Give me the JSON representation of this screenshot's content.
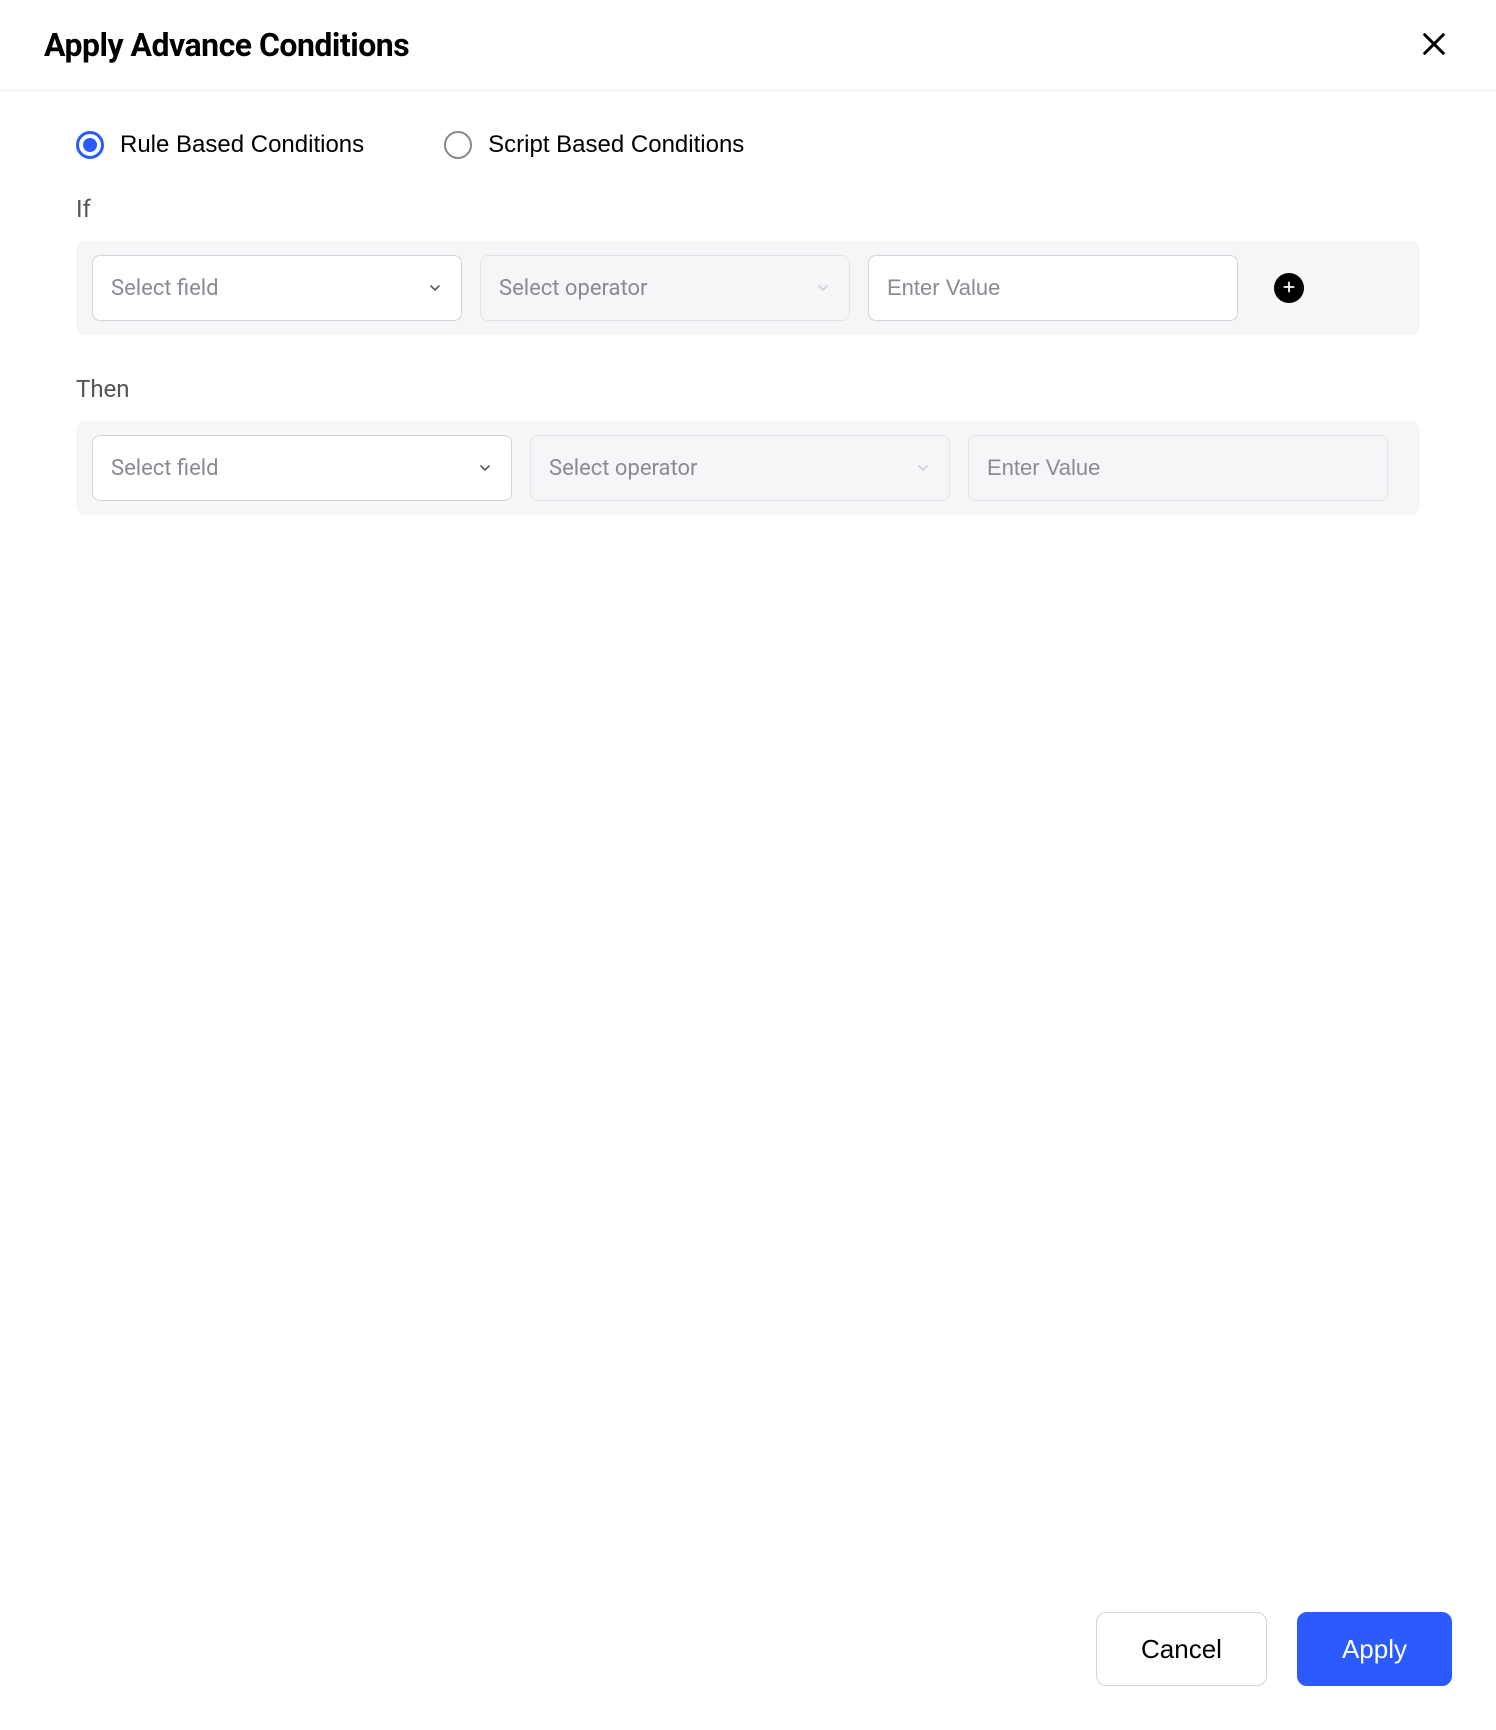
{
  "header": {
    "title": "Apply Advance Conditions"
  },
  "conditionType": {
    "options": {
      "rule": {
        "label": "Rule Based Conditions",
        "selected": true
      },
      "script": {
        "label": "Script Based Conditions",
        "selected": false
      }
    }
  },
  "ifSection": {
    "label": "If",
    "row": {
      "field": {
        "placeholder": "Select field",
        "value": ""
      },
      "operator": {
        "placeholder": "Select operator",
        "value": ""
      },
      "value": {
        "placeholder": "Enter Value",
        "value": ""
      }
    }
  },
  "thenSection": {
    "label": "Then",
    "row": {
      "field": {
        "placeholder": "Select field",
        "value": ""
      },
      "operator": {
        "placeholder": "Select operator",
        "value": ""
      },
      "value": {
        "placeholder": "Enter Value",
        "value": ""
      }
    }
  },
  "footer": {
    "cancel": "Cancel",
    "apply": "Apply"
  }
}
